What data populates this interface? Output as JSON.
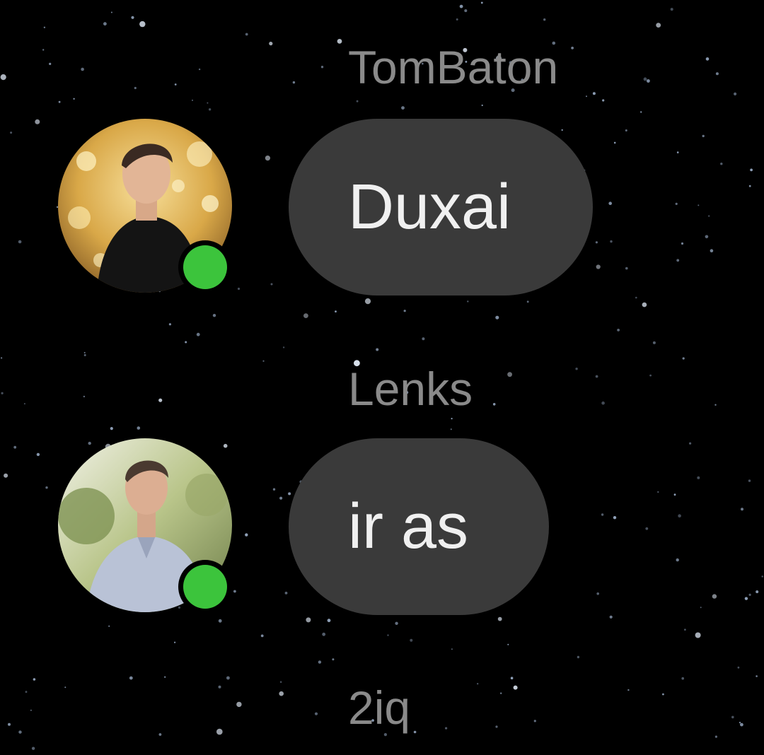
{
  "messages": [
    {
      "sender": "TomBaton",
      "text": "Duxai",
      "avatar_icon": "user-avatar-photo",
      "online": true
    },
    {
      "sender": "Lenks",
      "text": "ir as",
      "avatar_icon": "user-avatar-photo",
      "online": true
    },
    {
      "sender": "2iq"
    }
  ],
  "colors": {
    "background": "#000000",
    "bubble": "#3a3a3a",
    "bubble_text": "#f0f0f0",
    "sender_text": "#8a8a8a",
    "online_indicator": "#3cc43c"
  }
}
